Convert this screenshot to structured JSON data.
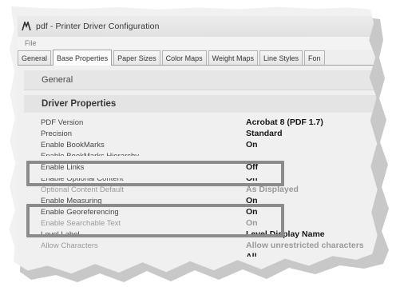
{
  "window": {
    "title": "pdf - Printer Driver Configuration",
    "icon": "printer-driver-icon"
  },
  "menu": [
    "File"
  ],
  "tabs": [
    {
      "label": "General",
      "active": false
    },
    {
      "label": "Base Properties",
      "active": true
    },
    {
      "label": "Paper Sizes",
      "active": false
    },
    {
      "label": "Color Maps",
      "active": false
    },
    {
      "label": "Weight Maps",
      "active": false
    },
    {
      "label": "Line Styles",
      "active": false
    },
    {
      "label": "Fon",
      "active": false
    }
  ],
  "panel": {
    "group_label": "General",
    "section_label": "Driver Properties",
    "rows": [
      {
        "label": "PDF Version",
        "value": "Acrobat 8 (PDF 1.7)"
      },
      {
        "label": "Precision",
        "value": "Standard"
      },
      {
        "label": "Enable BookMarks",
        "value": "On"
      },
      {
        "label": "Enable BookMarks Hierarchy",
        "value": "",
        "partial": "top"
      },
      {
        "label": "Enable Links",
        "value": "Off"
      },
      {
        "label": "Enable Optional Content",
        "value": "On",
        "partial": "bottom"
      },
      {
        "label": "Optional Content Default",
        "value": "As Displayed",
        "partial": "mid"
      },
      {
        "label": "Enable Measuring",
        "value": "On"
      },
      {
        "label": "Enable Georeferencing",
        "value": "On"
      },
      {
        "label": "Enable Searchable Text",
        "value": "On",
        "partial": "mid"
      },
      {
        "label": "Level Label",
        "value": "Level Display Name"
      },
      {
        "label": "Allow Characters",
        "value": "Allow unrestricted characters",
        "partial": "mid"
      },
      {
        "label": "",
        "value": "All",
        "partial": "top"
      }
    ]
  },
  "colors": {
    "highlight": "#8a8a8a",
    "panel": "#f2f2f2"
  }
}
